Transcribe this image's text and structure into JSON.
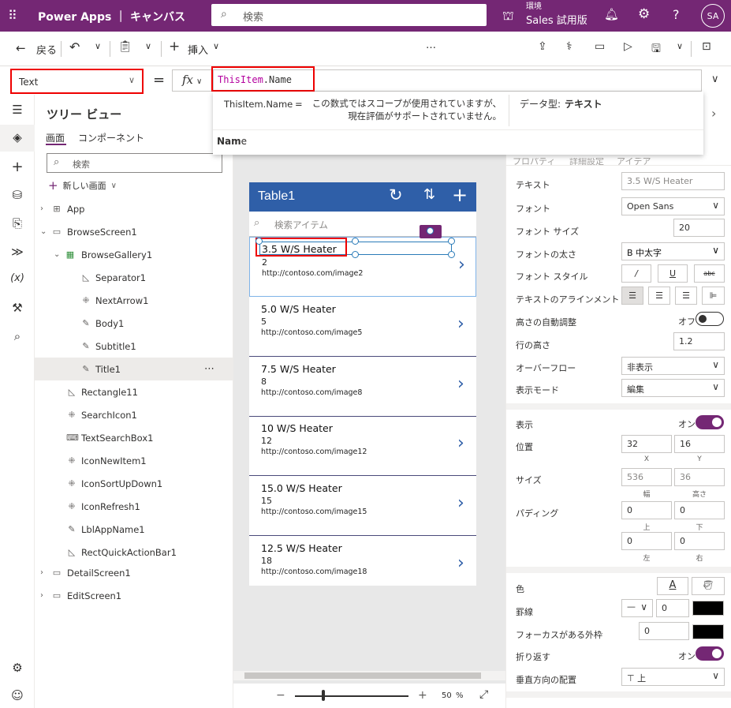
{
  "topbar": {
    "app_title": "Power Apps ｜ キャンバス",
    "search_placeholder": "検索",
    "env_label": "環境",
    "env_name": "Sales 試用版",
    "avatar": "SA"
  },
  "cmdbar": {
    "back": "戻る",
    "insert": "挿入",
    "font": "Open Sans",
    "font_size": "20",
    "more": "…"
  },
  "formula": {
    "property": "Text",
    "eq": "=",
    "fx": "fx",
    "keyword": "ThisItem",
    "rest": ".Name"
  },
  "intellisense": {
    "expr": "ThisItem.Name",
    "eq": "=",
    "message": "この数式ではスコープが使用されていますが、現在評価がサポートされていません。",
    "type_label": "データ型:",
    "type_value": "テキスト",
    "suggestion_bold": "Nam",
    "suggestion_rest": "e"
  },
  "tree": {
    "title": "ツリー ビュー",
    "tab_screen": "画面",
    "tab_components": "コンポーネント",
    "search_placeholder": "検索",
    "new_screen": "新しい画面",
    "items": [
      {
        "label": "App"
      },
      {
        "label": "BrowseScreen1"
      },
      {
        "label": "BrowseGallery1"
      },
      {
        "label": "Separator1"
      },
      {
        "label": "NextArrow1"
      },
      {
        "label": "Body1"
      },
      {
        "label": "Subtitle1"
      },
      {
        "label": "Title1",
        "more": "⋯"
      },
      {
        "label": "Rectangle11"
      },
      {
        "label": "SearchIcon1"
      },
      {
        "label": "TextSearchBox1"
      },
      {
        "label": "IconNewItem1"
      },
      {
        "label": "IconSortUpDown1"
      },
      {
        "label": "IconRefresh1"
      },
      {
        "label": "LblAppName1"
      },
      {
        "label": "RectQuickActionBar1"
      },
      {
        "label": "DetailScreen1"
      },
      {
        "label": "EditScreen1"
      }
    ]
  },
  "device": {
    "title": "Table1",
    "search_placeholder": "検索アイテム",
    "items": [
      {
        "title": "3.5 W/S Heater",
        "sub": "2",
        "body": "http://contoso.com/image2"
      },
      {
        "title": "5.0 W/S Heater",
        "sub": "5",
        "body": "http://contoso.com/image5"
      },
      {
        "title": "7.5 W/S Heater",
        "sub": "8",
        "body": "http://contoso.com/image8"
      },
      {
        "title": "10 W/S Heater",
        "sub": "12",
        "body": "http://contoso.com/image12"
      },
      {
        "title": "15.0 W/S Heater",
        "sub": "15",
        "body": "http://contoso.com/image15"
      },
      {
        "title": "12.5 W/S Heater",
        "sub": "18",
        "body": "http://contoso.com/image18"
      }
    ]
  },
  "zoom": {
    "minus": "−",
    "plus": "+",
    "value": "50",
    "unit": "%",
    "slider_fraction": 0.25
  },
  "props": {
    "tab_properties": "プロパティ",
    "tab_advanced": "詳細設定",
    "tab_ideas": "アイデア",
    "text_label": "テキスト",
    "text_value": "3.5 W/S Heater",
    "font_label": "フォント",
    "font_value": "Open Sans",
    "size_label": "フォント サイズ",
    "size_value": "20",
    "weight_label": "フォントの太さ",
    "weight_value": "B  中太字",
    "style_label": "フォント スタイル",
    "style_italic": "/",
    "style_underline": "U",
    "style_strike": "abc",
    "align_label": "テキストのアラインメント",
    "autoheight_label": "高さの自動調整",
    "autoheight_value": "オフ",
    "lineheight_label": "行の高さ",
    "lineheight_value": "1.2",
    "overflow_label": "オーバーフロー",
    "overflow_value": "非表示",
    "mode_label": "表示モード",
    "mode_value": "編集",
    "visible_label": "表示",
    "visible_value": "オン",
    "position_label": "位置",
    "x_value": "32",
    "y_value": "16",
    "x_cap": "X",
    "y_cap": "Y",
    "size2_label": "サイズ",
    "w_value": "536",
    "h_value": "36",
    "w_cap": "幅",
    "h_cap": "高さ",
    "padding_label": "パディング",
    "pad_top": "0",
    "pad_bottom": "0",
    "pad_left": "0",
    "pad_right": "0",
    "pad_top_cap": "上",
    "pad_bottom_cap": "下",
    "pad_left_cap": "左",
    "pad_right_cap": "右",
    "color_label": "色",
    "border_label": "罫線",
    "border_value": "0",
    "focus_label": "フォーカスがある外枠",
    "focus_value": "0",
    "wrap_label": "折り返す",
    "wrap_value": "オン",
    "valign_label": "垂直方向の配置",
    "valign_value": "上"
  }
}
